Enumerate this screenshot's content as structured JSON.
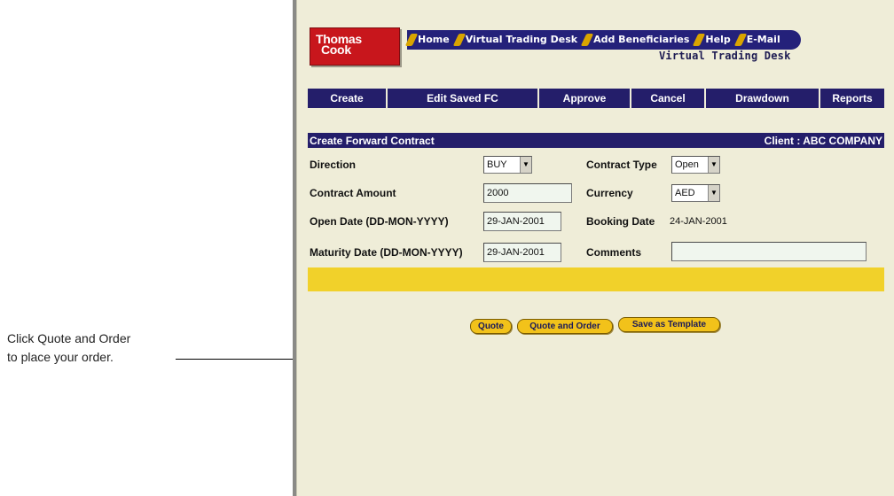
{
  "callout": {
    "line1": "Click Quote and Order",
    "line2": "to place your order."
  },
  "header": {
    "logo_line1": "Thomas",
    "logo_line2": "Cook",
    "subtitle": "Virtual Trading Desk",
    "nav": [
      "Home",
      "Virtual Trading Desk",
      "Add Beneficiaries",
      "Help",
      "E-Mail"
    ]
  },
  "menubar": [
    "Create",
    "Edit Saved FC",
    "Approve",
    "Cancel",
    "Drawdown",
    "Reports"
  ],
  "form": {
    "title": "Create Forward Contract",
    "client": "Client : ABC COMPANY",
    "direction_label": "Direction",
    "direction_value": "BUY",
    "contract_type_label": "Contract Type",
    "contract_type_value": "Open",
    "amount_label": "Contract Amount",
    "amount_value": "2000",
    "currency_label": "Currency",
    "currency_value": "AED",
    "open_date_label": "Open Date (DD-MON-YYYY)",
    "open_date_value": "29-JAN-2001",
    "booking_date_label": "Booking Date",
    "booking_date_value": "24-JAN-2001",
    "maturity_date_label": "Maturity Date (DD-MON-YYYY)",
    "maturity_date_value": "29-JAN-2001",
    "comments_label": "Comments",
    "comments_value": ""
  },
  "buttons": {
    "quote": "Quote",
    "quote_order": "Quote and Order",
    "template": "Save as Template"
  },
  "colors": {
    "nav_bg": "#241e6a",
    "logo_red": "#c8161c",
    "accent_yellow": "#f1d12a",
    "panel_bg": "#efedd8"
  }
}
